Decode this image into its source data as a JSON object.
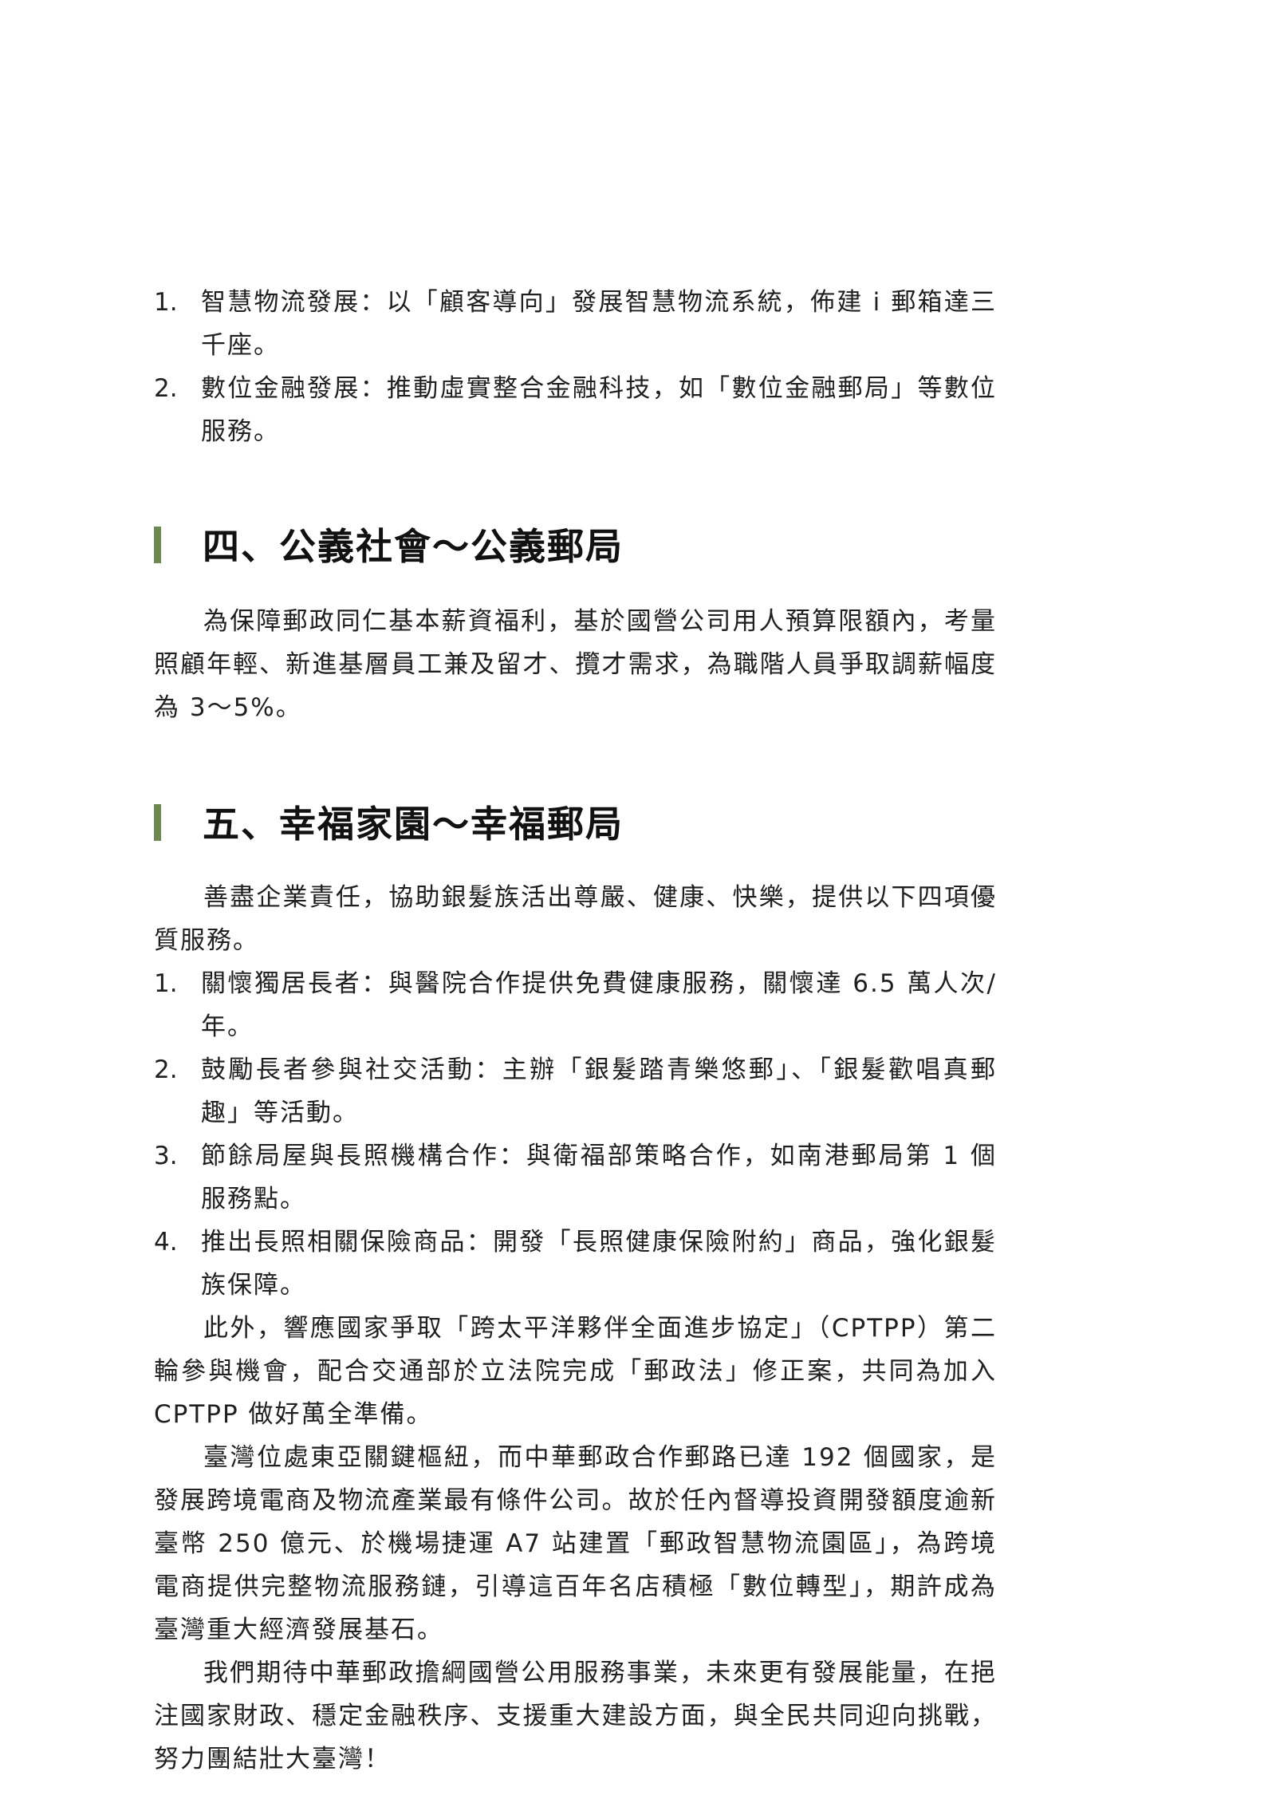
{
  "colors": {
    "heading_bar": "#6b8a4e",
    "text": "#1f1f1f"
  },
  "intro_list": [
    {
      "num": "1.",
      "text": "智慧物流發展：以「顧客導向」發展智慧物流系統，佈建 i 郵箱達三千座。"
    },
    {
      "num": "2.",
      "text": "數位金融發展：推動虛實整合金融科技，如「數位金融郵局」等數位服務。"
    }
  ],
  "section4": {
    "title": "四、公義社會～公義郵局",
    "paragraph": "為保障郵政同仁基本薪資福利，基於國營公司用人預算限額內，考量照顧年輕、新進基層員工兼及留才、攬才需求，為職階人員爭取調薪幅度為 3～5%。"
  },
  "section5": {
    "title": "五、幸福家園～幸福郵局",
    "intro": "善盡企業責任，協助銀髮族活出尊嚴、健康、快樂，提供以下四項優質服務。",
    "list": [
      {
        "num": "1.",
        "text": "關懷獨居長者：與醫院合作提供免費健康服務，關懷達 6.5 萬人次/年。"
      },
      {
        "num": "2.",
        "text": "鼓勵長者參與社交活動：主辦「銀髮踏青樂悠郵」、「銀髮歡唱真郵趣」等活動。"
      },
      {
        "num": "3.",
        "text": "節餘局屋與長照機構合作：與衛福部策略合作，如南港郵局第 1 個服務點。"
      },
      {
        "num": "4.",
        "text": "推出長照相關保險商品：開發「長照健康保險附約」商品，強化銀髮族保障。"
      }
    ],
    "paragraphs": [
      "此外，響應國家爭取「跨太平洋夥伴全面進步協定」（CPTPP）第二輪參與機會，配合交通部於立法院完成「郵政法」修正案，共同為加入 CPTPP 做好萬全準備。",
      "臺灣位處東亞關鍵樞紐，而中華郵政合作郵路已達 192 個國家，是發展跨境電商及物流產業最有條件公司。故於任內督導投資開發額度逾新臺幣 250 億元、於機場捷運 A7 站建置「郵政智慧物流園區」，為跨境電商提供完整物流服務鏈，引導這百年名店積極「數位轉型」，期許成為臺灣重大經濟發展基石。",
      "我們期待中華郵政擔綱國營公用服務事業，未來更有發展能量，在挹注國家財政、穩定金融秩序、支援重大建設方面，與全民共同迎向挑戰，努力團結壯大臺灣！"
    ]
  }
}
